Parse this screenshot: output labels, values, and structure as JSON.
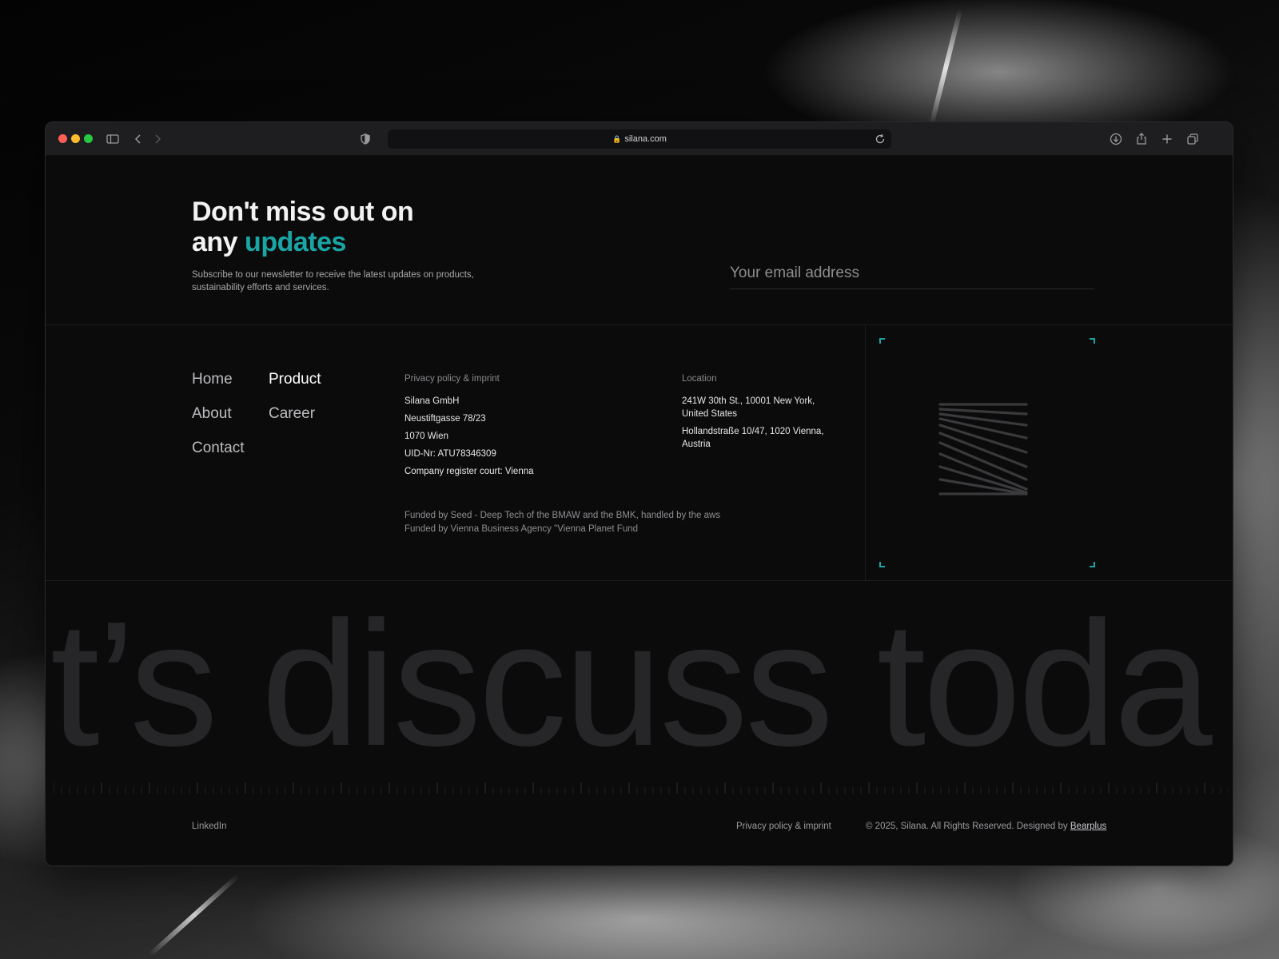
{
  "browser": {
    "url": "silana.com",
    "lock_icon": "lock-icon"
  },
  "newsletter": {
    "title_line1": "Don't miss out on",
    "title_line2_prefix": "any ",
    "title_line2_accent": "updates",
    "description": "Subscribe to our newsletter to receive the latest updates on products, sustainability efforts and services.",
    "email_placeholder": "Your email address",
    "accent_color": "#1aa5a5"
  },
  "nav": {
    "home": "Home",
    "product": "Product",
    "about": "About",
    "career": "Career",
    "contact": "Contact"
  },
  "company": {
    "heading": "Privacy policy & imprint",
    "name": "Silana GmbH",
    "street": "Neustiftgasse 78/23",
    "city": "1070 Wien",
    "uid": "UID-Nr: ATU78346309",
    "court": "Company register court: Vienna"
  },
  "location": {
    "heading": "Location",
    "address_1": "241W 30th St., 10001 New York, United States",
    "address_2": "Hollandstraße 10/47, 1020 Vienna, Austria"
  },
  "funding": {
    "line_1": "Funded by Seed - Deep Tech of the BMAW and the BMK, handled by the aws",
    "line_2": "Funded by Vienna Business Agency \"Vienna Planet Fund"
  },
  "hero_text": "t’s discuss toda",
  "footer": {
    "linkedin": "LinkedIn",
    "privacy": "Privacy policy & imprint",
    "copyright": "© 2025, Silana. All Rights Reserved. Designed by ",
    "designer": "Bearplus"
  }
}
